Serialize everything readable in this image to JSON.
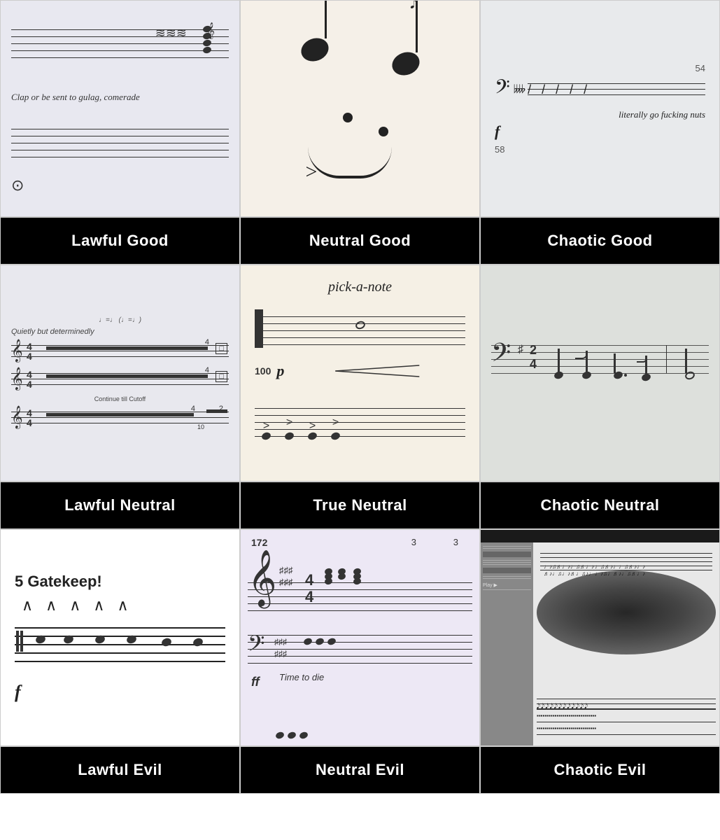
{
  "grid": {
    "cells": [
      {
        "id": "lawful-good",
        "type": "image",
        "label": "Lawful Good",
        "description": "Sheet music with clap or be sent to gulag text"
      },
      {
        "id": "neutral-good",
        "type": "image",
        "label": "Neutral Good",
        "description": "Sheet music notes forming a smiley face"
      },
      {
        "id": "chaotic-good",
        "type": "image",
        "label": "Chaotic Good",
        "description": "Sheet music saying literally go fucking nuts forte"
      },
      {
        "id": "lawful-neutral",
        "type": "image",
        "label": "Lawful Neutral",
        "description": "Sheet music with quietly but determinedly and continue till cutoff"
      },
      {
        "id": "true-neutral",
        "type": "image",
        "label": "True Neutral",
        "description": "Sheet music with pick-a-note instruction"
      },
      {
        "id": "chaotic-neutral",
        "type": "image",
        "label": "Chaotic Neutral",
        "description": "Bass clef sheet music with sharp key signature"
      },
      {
        "id": "lawful-evil",
        "type": "image",
        "label": "Lawful Evil",
        "description": "Sheet music with 5 Gatekeep text and forte dynamic"
      },
      {
        "id": "neutral-evil",
        "type": "image",
        "label": "Neutral Evil",
        "description": "Sheet music at tempo 172 with Time to die text"
      },
      {
        "id": "chaotic-evil",
        "type": "image",
        "label": "Chaotic Evil",
        "description": "Extremely dense chaotic sheet music notation"
      }
    ],
    "labels": {
      "lawful_good": "Lawful Good",
      "neutral_good": "Neutral Good",
      "chaotic_good": "Chaotic Good",
      "lawful_neutral": "Lawful Neutral",
      "true_neutral": "True Neutral",
      "chaotic_neutral": "Chaotic Neutral",
      "lawful_evil": "Lawful Evil",
      "neutral_evil": "Neutral Evil",
      "chaotic_evil": "Chaotic Evil"
    },
    "texts": {
      "gulag": "Clap or be sent to gulag, comerade",
      "nuts": "literally go fucking nuts",
      "quietly": "Quietly but determinedly",
      "continue": "Continue till Cutoff",
      "pick_a_note": "pick-a-note",
      "gatekeep": "5 Gatekeep!",
      "time_to_die": "Time to die",
      "tempo_172": "172",
      "dynamic_f": "f",
      "dynamic_ff": "ff",
      "dynamic_p": "p",
      "measure_54": "54",
      "measure_58": "58",
      "tempo_100": "100"
    }
  }
}
